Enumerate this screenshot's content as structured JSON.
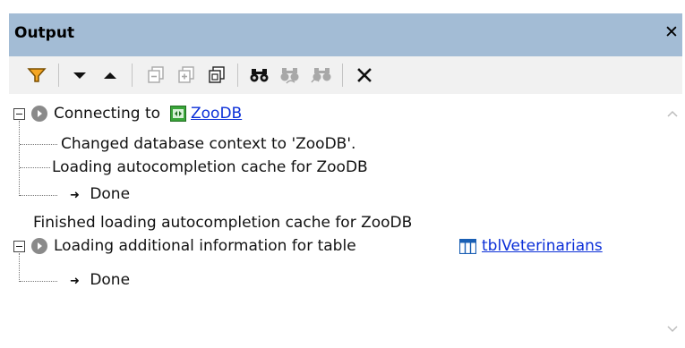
{
  "panel": {
    "title": "Output",
    "close_glyph": "✕"
  },
  "toolbar": {
    "buttons": [
      {
        "name": "filter-icon",
        "enabled": true
      },
      {
        "name": "next-message-icon",
        "enabled": true
      },
      {
        "name": "previous-message-icon",
        "enabled": true
      },
      {
        "name": "collapse-all-icon",
        "enabled": false
      },
      {
        "name": "expand-all-icon",
        "enabled": false
      },
      {
        "name": "copy-icon",
        "enabled": true
      },
      {
        "name": "find-icon",
        "enabled": true
      },
      {
        "name": "find-previous-icon",
        "enabled": false
      },
      {
        "name": "find-next-icon",
        "enabled": false
      },
      {
        "name": "clear-icon",
        "enabled": true
      }
    ],
    "colors": {
      "filter": "#f5a623",
      "filter_outline": "#7a4f00",
      "disabled": "#a8a8a8"
    }
  },
  "messages": {
    "connecting_prefix": "Connecting to",
    "connecting_db": "ZooDB",
    "changed_context": "Changed database context to 'ZooDB'.",
    "loading_cache": "Loading autocompletion cache for ZooDB",
    "done_1": "Done",
    "finished_cache": "Finished loading autocompletion cache for ZooDB",
    "loading_additional_prefix": "Loading additional information for table",
    "table_name": "tblVeterinarians",
    "done_2": "Done",
    "arrow_glyph": "➜"
  },
  "colors": {
    "title_bar": "#a3bcd5",
    "toolbar_bg": "#f1f1f1",
    "link": "#0b2fd8",
    "db_icon": "#3aa53a",
    "table_icon": "#1a5fb4"
  }
}
